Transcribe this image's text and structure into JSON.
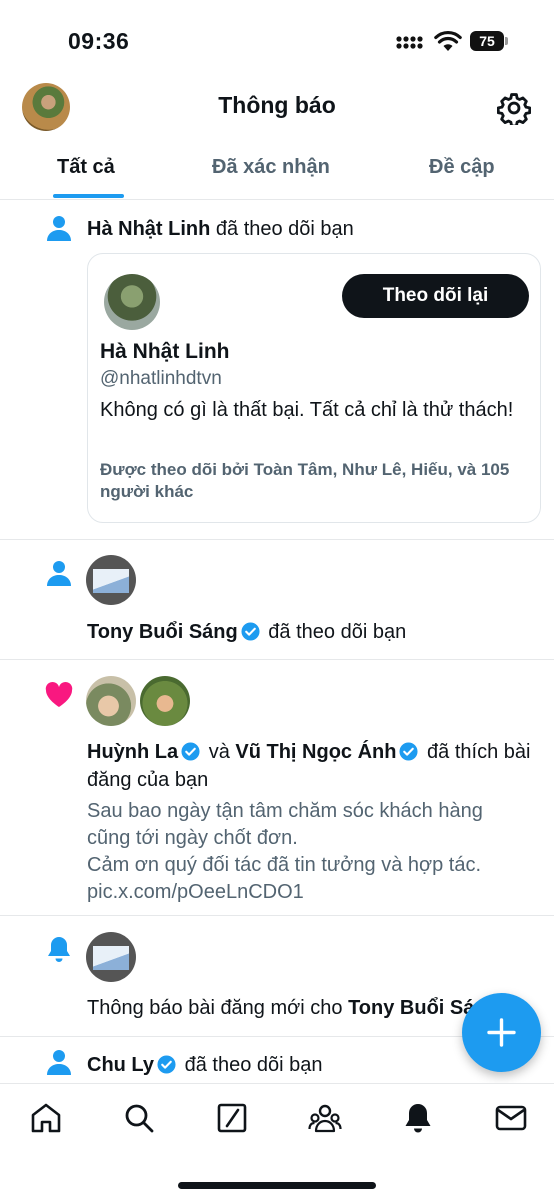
{
  "status_bar": {
    "time": "09:36",
    "battery": "75"
  },
  "header": {
    "title": "Thông báo"
  },
  "tabs": [
    {
      "label": "Tất cả",
      "active": true
    },
    {
      "label": "Đã xác nhận",
      "active": false
    },
    {
      "label": "Đề cập",
      "active": false
    }
  ],
  "notifications": {
    "n1": {
      "name": "Hà Nhật Linh",
      "action": " đã theo dõi bạn",
      "card": {
        "button": "Theo dõi lại",
        "name": "Hà Nhật Linh",
        "handle": "@nhatlinhdtvn",
        "bio": "Không có gì là thất bại. Tất cả chỉ là thử thách!",
        "followed_by": "Được theo dõi bởi Toàn Tâm, Như Lê, Hiếu, và 105 người khác"
      }
    },
    "n2": {
      "name": "Tony Buổi Sáng",
      "action": "đã theo dõi bạn"
    },
    "n3": {
      "name1": "Huỳnh La",
      "conj": "và",
      "name2": "Vũ Thị Ngọc Ánh",
      "action": "đã thích bài",
      "action2": "đăng của bạn",
      "preview": [
        "Sau bao ngày tận tâm chăm sóc khách hàng",
        "cũng tới ngày chốt đơn.",
        "Cảm ơn quý đối tác đã tin tưởng và hợp tác.",
        "pic.x.com/pOeeLnCDO1"
      ]
    },
    "n4": {
      "text": "Thông báo bài đăng mới cho ",
      "name": "Tony Buổi Sáng"
    },
    "n5": {
      "name": "Chu Ly",
      "action": "đã theo dõi bạn"
    }
  },
  "colors": {
    "accent": "#1d9bf0",
    "like": "#f91880",
    "text": "#0f1419",
    "secondary": "#536471"
  },
  "icons": {
    "nav": [
      "home-icon",
      "search-icon",
      "grok-icon",
      "communities-icon",
      "notifications-icon",
      "messages-icon"
    ]
  }
}
